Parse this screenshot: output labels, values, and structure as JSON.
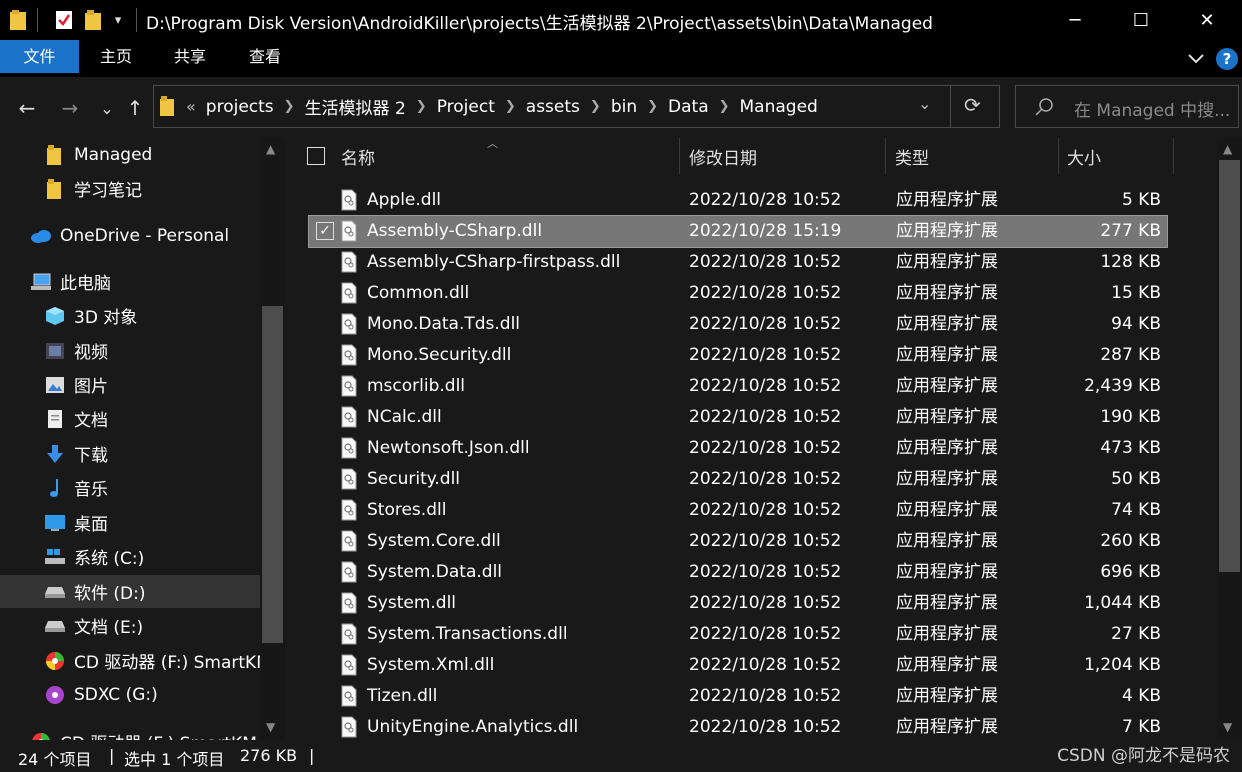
{
  "window": {
    "title": "D:\\Program Disk Version\\AndroidKiller\\projects\\生活模拟器 2\\Project\\assets\\bin\\Data\\Managed",
    "quick_access_dropdown": "▾",
    "minimize": "─",
    "maximize": "☐",
    "close": "✕"
  },
  "ribbon": {
    "tabs": [
      "文件",
      "主页",
      "共享",
      "查看"
    ],
    "expand_icon": "chevron-down-icon",
    "help": "?"
  },
  "nav": {
    "back": "←",
    "forward": "→",
    "recent": "⌄",
    "up": "↑",
    "refresh": "⟳",
    "address_overflow": "«",
    "breadcrumbs": [
      "projects",
      "生活模拟器 2",
      "Project",
      "assets",
      "bin",
      "Data",
      "Managed"
    ],
    "address_dropdown": "⌄",
    "search_placeholder": "在 Managed 中搜..."
  },
  "sidebar": {
    "items": [
      {
        "label": "Managed",
        "icon": "folder-icon"
      },
      {
        "label": "学习笔记",
        "icon": "folder-icon"
      },
      {
        "label": "OneDrive - Personal",
        "icon": "cloud-icon"
      },
      {
        "label": "此电脑",
        "icon": "computer-icon"
      },
      {
        "label": "3D 对象",
        "icon": "3d-objects-icon"
      },
      {
        "label": "视频",
        "icon": "video-icon"
      },
      {
        "label": "图片",
        "icon": "picture-icon"
      },
      {
        "label": "文档",
        "icon": "document-icon"
      },
      {
        "label": "下载",
        "icon": "download-icon"
      },
      {
        "label": "音乐",
        "icon": "music-icon"
      },
      {
        "label": "桌面",
        "icon": "desktop-icon"
      },
      {
        "label": "系统 (C:)",
        "icon": "windows-drive-icon"
      },
      {
        "label": "软件 (D:)",
        "icon": "drive-icon"
      },
      {
        "label": "文档 (E:)",
        "icon": "drive-icon"
      },
      {
        "label": "CD 驱动器 (F:) SmartKM",
        "icon": "cd-drive-icon"
      },
      {
        "label": "SDXC (G:)",
        "icon": "sd-card-icon"
      },
      {
        "label": "CD 驱动器 (F:) SmartKM",
        "icon": "cd-drive-icon"
      }
    ],
    "selected_index": 12
  },
  "columns": {
    "name": "名称",
    "date": "修改日期",
    "type": "类型",
    "size": "大小"
  },
  "files": [
    {
      "name": "Apple.dll",
      "date": "2022/10/28 10:52",
      "type": "应用程序扩展",
      "size": "5 KB"
    },
    {
      "name": "Assembly-CSharp.dll",
      "date": "2022/10/28 15:19",
      "type": "应用程序扩展",
      "size": "277 KB"
    },
    {
      "name": "Assembly-CSharp-firstpass.dll",
      "date": "2022/10/28 10:52",
      "type": "应用程序扩展",
      "size": "128 KB"
    },
    {
      "name": "Common.dll",
      "date": "2022/10/28 10:52",
      "type": "应用程序扩展",
      "size": "15 KB"
    },
    {
      "name": "Mono.Data.Tds.dll",
      "date": "2022/10/28 10:52",
      "type": "应用程序扩展",
      "size": "94 KB"
    },
    {
      "name": "Mono.Security.dll",
      "date": "2022/10/28 10:52",
      "type": "应用程序扩展",
      "size": "287 KB"
    },
    {
      "name": "mscorlib.dll",
      "date": "2022/10/28 10:52",
      "type": "应用程序扩展",
      "size": "2,439 KB"
    },
    {
      "name": "NCalc.dll",
      "date": "2022/10/28 10:52",
      "type": "应用程序扩展",
      "size": "190 KB"
    },
    {
      "name": "Newtonsoft.Json.dll",
      "date": "2022/10/28 10:52",
      "type": "应用程序扩展",
      "size": "473 KB"
    },
    {
      "name": "Security.dll",
      "date": "2022/10/28 10:52",
      "type": "应用程序扩展",
      "size": "50 KB"
    },
    {
      "name": "Stores.dll",
      "date": "2022/10/28 10:52",
      "type": "应用程序扩展",
      "size": "74 KB"
    },
    {
      "name": "System.Core.dll",
      "date": "2022/10/28 10:52",
      "type": "应用程序扩展",
      "size": "260 KB"
    },
    {
      "name": "System.Data.dll",
      "date": "2022/10/28 10:52",
      "type": "应用程序扩展",
      "size": "696 KB"
    },
    {
      "name": "System.dll",
      "date": "2022/10/28 10:52",
      "type": "应用程序扩展",
      "size": "1,044 KB"
    },
    {
      "name": "System.Transactions.dll",
      "date": "2022/10/28 10:52",
      "type": "应用程序扩展",
      "size": "27 KB"
    },
    {
      "name": "System.Xml.dll",
      "date": "2022/10/28 10:52",
      "type": "应用程序扩展",
      "size": "1,204 KB"
    },
    {
      "name": "Tizen.dll",
      "date": "2022/10/28 10:52",
      "type": "应用程序扩展",
      "size": "4 KB"
    },
    {
      "name": "UnityEngine.Analytics.dll",
      "date": "2022/10/28 10:52",
      "type": "应用程序扩展",
      "size": "7 KB"
    }
  ],
  "selected_file_index": 1,
  "status": {
    "count": "24 个项目",
    "selection": "选中 1 个项目",
    "size": "276 KB",
    "divider": "|"
  },
  "watermark": "CSDN @阿龙不是码农",
  "colors": {
    "accent": "#1a73c9",
    "folder": "#f0c541",
    "selected_row": "#777777"
  }
}
